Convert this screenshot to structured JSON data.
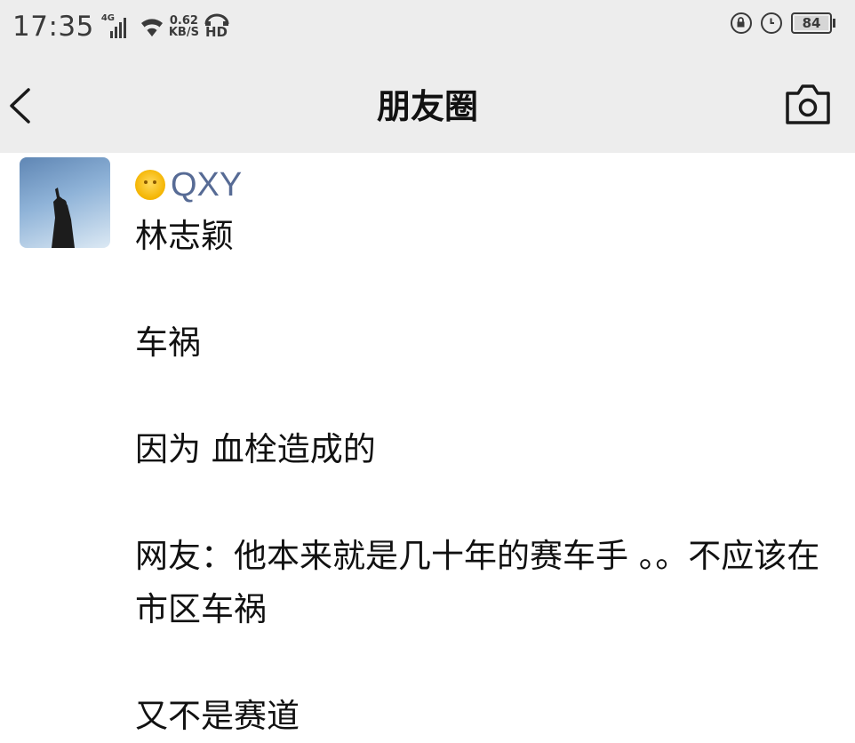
{
  "status_bar": {
    "time": "17:35",
    "network_type": "4G",
    "speed_value": "0.62",
    "speed_unit": "KB/S",
    "hd_label": "HD",
    "battery_level": "84"
  },
  "nav": {
    "title": "朋友圈"
  },
  "post": {
    "author_name": "QXY",
    "author_emoji": "sun-face-icon",
    "paragraphs": [
      "林志颖",
      "车祸",
      "因为  血栓造成的",
      "网友：他本来就是几十年的赛车手  。。不应该在市区车祸",
      "又不是赛道"
    ]
  },
  "colors": {
    "bar_background": "#ededed",
    "author_link": "#576b95",
    "text": "#111111"
  }
}
